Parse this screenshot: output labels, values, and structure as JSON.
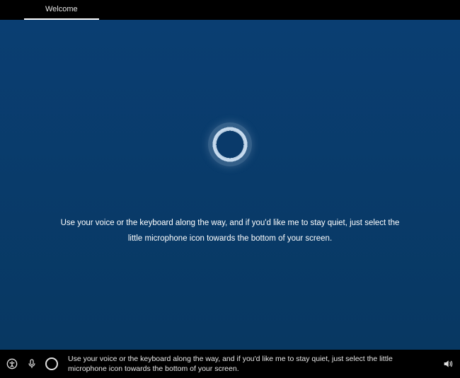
{
  "header": {
    "tab_label": "Welcome"
  },
  "main": {
    "message": "Use your voice or the keyboard along the way, and if you'd like me to stay quiet, just select the little microphone icon towards the bottom of your screen."
  },
  "footer": {
    "caption": "Use your voice or the keyboard along the way, and if you'd like me to stay quiet, just select the little microphone icon towards the bottom of your screen."
  },
  "icons": {
    "accessibility": "accessibility-icon",
    "microphone": "microphone-icon",
    "cortana": "cortana-ring-icon",
    "volume": "volume-icon"
  },
  "colors": {
    "background_main": "#0a3a6a",
    "background_bars": "#000000",
    "text_primary": "#ffffff",
    "ring_light": "#b9cee2"
  }
}
